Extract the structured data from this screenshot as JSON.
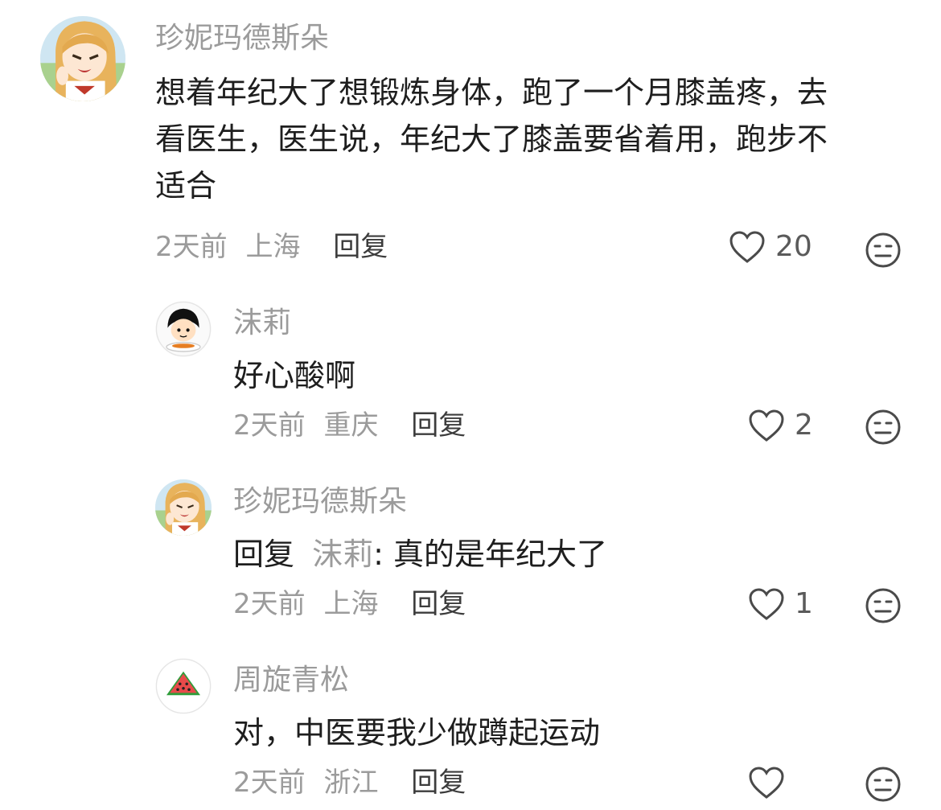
{
  "comments": [
    {
      "username": "珍妮玛德斯朵",
      "lines": [
        "想着年纪大了想锻炼身体，跑了一个月膝盖疼，去",
        "看医生，医生说，年纪大了膝盖要省着用，跑步不",
        "适合"
      ],
      "time": "2天前",
      "location": "上海",
      "reply_label": "回复",
      "likes": "20",
      "avatar_icon": "anime-girl-avatar"
    },
    {
      "username": "沫莉",
      "lines": [
        "好心酸啊"
      ],
      "time": "2天前",
      "location": "重庆",
      "reply_label": "回复",
      "likes": "2",
      "avatar_icon": "cartoon-boy-avatar"
    },
    {
      "username": "珍妮玛德斯朵",
      "reply_prefix": "回复",
      "reply_to": "沫莉",
      "reply_sep": ":",
      "text": "真的是年纪大了",
      "time": "2天前",
      "location": "上海",
      "reply_label": "回复",
      "likes": "1",
      "avatar_icon": "anime-girl-avatar"
    },
    {
      "username": "周旋青松",
      "lines": [
        "对，中医要我少做蹲起运动"
      ],
      "time": "2天前",
      "location": "浙江",
      "reply_label": "回复",
      "likes": "",
      "avatar_icon": "watermelon-avatar"
    }
  ],
  "colors": {
    "name": "#9b9b9b",
    "text": "#1e1e1e",
    "meta": "#9b9b9b",
    "reply": "#3c3c3c",
    "icon": "#4a4a4a"
  }
}
